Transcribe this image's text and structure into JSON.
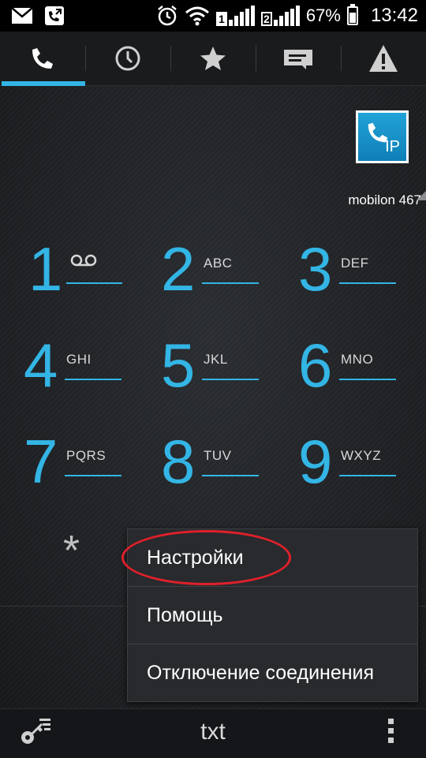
{
  "status_bar": {
    "battery": "67%",
    "time": "13:42",
    "sim1": "1",
    "sim2": "2"
  },
  "tabs": [
    {
      "name": "phone-icon",
      "active": true
    },
    {
      "name": "clock-icon",
      "active": false
    },
    {
      "name": "star-icon",
      "active": false
    },
    {
      "name": "message-icon",
      "active": false
    },
    {
      "name": "warning-icon",
      "active": false
    }
  ],
  "ip_badge": {
    "label": "IP"
  },
  "operator": "mobilon 467",
  "keypad": [
    {
      "digit": "1",
      "letters": ""
    },
    {
      "digit": "2",
      "letters": "ABC"
    },
    {
      "digit": "3",
      "letters": "DEF"
    },
    {
      "digit": "4",
      "letters": "GHI"
    },
    {
      "digit": "5",
      "letters": "JKL"
    },
    {
      "digit": "6",
      "letters": "MNO"
    },
    {
      "digit": "7",
      "letters": "PQRS"
    },
    {
      "digit": "8",
      "letters": "TUV"
    },
    {
      "digit": "9",
      "letters": "WXYZ"
    }
  ],
  "star_key": "*",
  "menu": {
    "items": [
      "Настройки",
      "Помощь",
      "Отключение соединения"
    ]
  },
  "bottom_bar": {
    "txt": "txt"
  },
  "colors": {
    "accent": "#33b5e5",
    "highlight": "#e0202a"
  }
}
